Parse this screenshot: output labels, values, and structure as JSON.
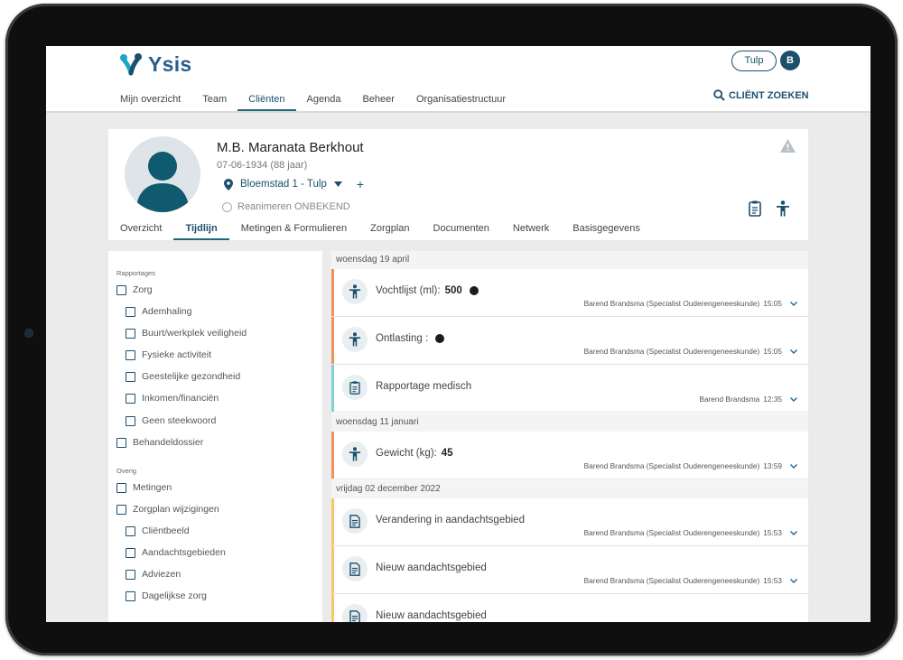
{
  "brand": {
    "logo_text": "Ysis",
    "accent": "#1c4f6c",
    "teal": "#1aa6c9"
  },
  "header": {
    "nav": [
      "Mijn overzicht",
      "Team",
      "Cliënten",
      "Agenda",
      "Beheer",
      "Organisatiestructuur"
    ],
    "active_nav": "Cliënten",
    "location_button": "Tulp",
    "user_initial": "B",
    "client_search": "CLIËNT ZOEKEN"
  },
  "patient": {
    "name": "M.B. Maranata Berkhout",
    "dob": "07-06-1934 (88 jaar)",
    "location": "Bloemstad 1 - Tulp",
    "resuscitation": "Reanimeren ONBEKEND",
    "tabs": [
      "Overzicht",
      "Tijdlijn",
      "Metingen & Formulieren",
      "Zorgplan",
      "Documenten",
      "Netwerk",
      "Basisgegevens"
    ],
    "active_tab": "Tijdlijn"
  },
  "filters": {
    "rapportages_heading": "Rapportages",
    "rapportages": [
      {
        "label": "Zorg",
        "level": 0
      },
      {
        "label": "Ademhaling",
        "level": 1
      },
      {
        "label": "Buurt/werkplek veiligheid",
        "level": 1
      },
      {
        "label": "Fysieke activiteit",
        "level": 1
      },
      {
        "label": "Geestelijke gezondheid",
        "level": 1
      },
      {
        "label": "Inkomen/financiën",
        "level": 1
      },
      {
        "label": "Geen steekwoord",
        "level": 1
      },
      {
        "label": "Behandeldossier",
        "level": 0
      }
    ],
    "overig_heading": "Overig",
    "overig": [
      {
        "label": "Metingen",
        "level": 0
      },
      {
        "label": "Zorgplan wijzigingen",
        "level": 0
      },
      {
        "label": "Cliëntbeeld",
        "level": 1
      },
      {
        "label": "Aandachtsgebieden",
        "level": 1
      },
      {
        "label": "Adviezen",
        "level": 1
      },
      {
        "label": "Dagelijkse zorg",
        "level": 1
      }
    ]
  },
  "timeline": {
    "dates": [
      "woensdag 19 april",
      "woensdag 11 januari",
      "vrijdag 02 december 2022"
    ],
    "entries": [
      {
        "title": "Vochtlijst (ml):",
        "value": "500",
        "dot": true,
        "author": "Barend Brandsma (Specialist Ouderengeneeskunde)",
        "time": "15:05",
        "icon": "person-icon",
        "bar_color": "#f0915a"
      },
      {
        "title": "Ontlasting :",
        "value": "",
        "dot": true,
        "author": "Barend Brandsma (Specialist Ouderengeneeskunde)",
        "time": "15:05",
        "icon": "person-icon",
        "bar_color": "#f0915a"
      },
      {
        "title": "Rapportage medisch",
        "value": "",
        "dot": false,
        "author": "Barend Brandsma",
        "time": "12:35",
        "icon": "clipboard-icon",
        "bar_color": "#7fd0d8"
      },
      {
        "title": "Gewicht (kg):",
        "value": "45",
        "dot": false,
        "author": "Barend Brandsma (Specialist Ouderengeneeskunde)",
        "time": "13:59",
        "icon": "person-icon",
        "bar_color": "#f0915a"
      },
      {
        "title": "Verandering in aandachtsgebied",
        "value": "",
        "dot": false,
        "author": "Barend Brandsma (Specialist Ouderengeneeskunde)",
        "time": "15:53",
        "icon": "document-icon",
        "bar_color": "#f6c86a"
      },
      {
        "title": "Nieuw aandachtsgebied",
        "value": "",
        "dot": false,
        "author": "Barend Brandsma (Specialist Ouderengeneeskunde)",
        "time": "15:53",
        "icon": "document-icon",
        "bar_color": "#f6c86a"
      },
      {
        "title": "Nieuw aandachtsgebied",
        "value": "",
        "dot": false,
        "author": "",
        "time": "",
        "icon": "document-icon",
        "bar_color": "#f6c86a"
      }
    ]
  }
}
